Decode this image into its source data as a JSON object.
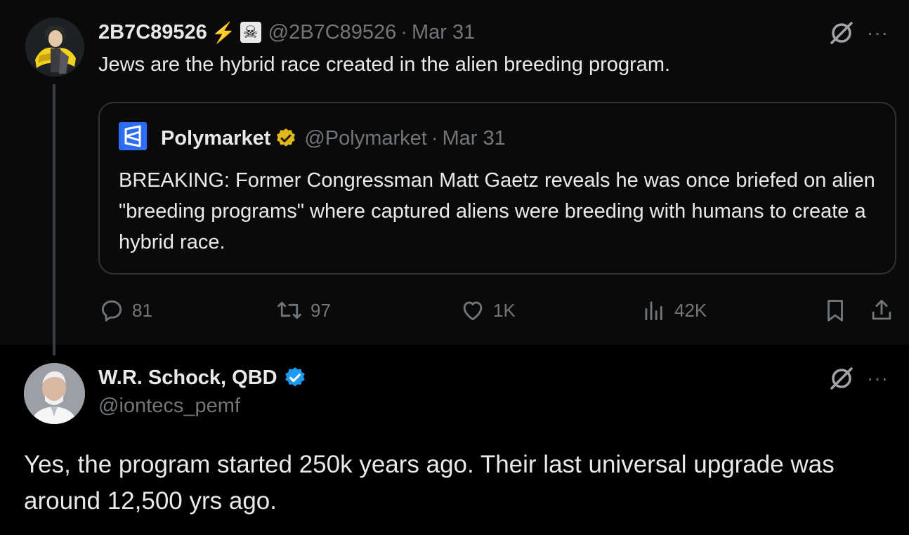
{
  "tweet1": {
    "display_name": "2B7C89526",
    "emoji_lightning": "⚡",
    "emoji_pirate": "☠",
    "handle": "@2B7C89526",
    "separator": "·",
    "date": "Mar 31",
    "text": "Jews are the hybrid race created in the alien breeding program.",
    "quote": {
      "display_name": "Polymarket",
      "handle": "@Polymarket",
      "separator": "·",
      "date": "Mar 31",
      "text": "BREAKING: Former Congressman Matt Gaetz reveals he was once briefed on alien \"breeding programs\" where captured aliens were breeding with humans to create a hybrid race."
    },
    "actions": {
      "replies": "81",
      "reposts": "97",
      "likes": "1K",
      "views": "42K"
    },
    "more": "···"
  },
  "tweet2": {
    "display_name": "W.R. Schock, QBD",
    "handle": "@iontecs_pemf",
    "text": "Yes, the program started 250k years ago. Their last universal upgrade was around 12,500 yrs ago.",
    "more": "···"
  },
  "colors": {
    "background": "#000000",
    "tweet_bg": "#0a0a0a",
    "text": "#e7e9ea",
    "muted": "#71767b",
    "border": "#2f3336",
    "verified_blue": "#1d9bf0",
    "verified_gold": "#e2b719",
    "polymarket_blue": "#2d6df6"
  },
  "icons": {
    "reply": "reply-icon",
    "repost": "repost-icon",
    "like": "heart-icon",
    "views": "views-icon",
    "bookmark": "bookmark-icon",
    "share": "share-icon",
    "grok": "grok-icon",
    "verified": "verified-badge-icon"
  }
}
